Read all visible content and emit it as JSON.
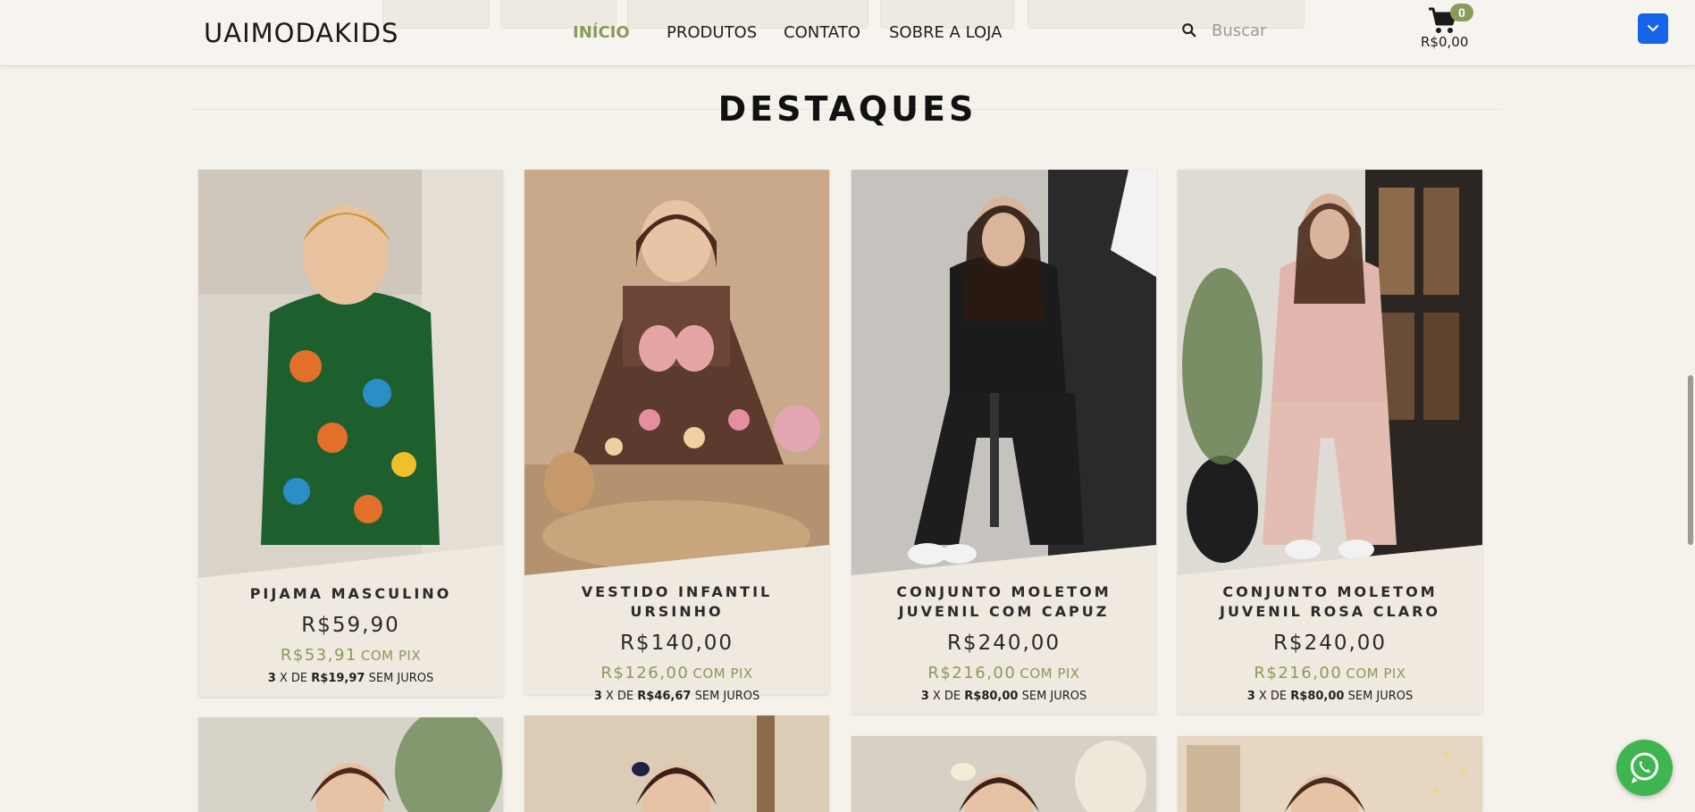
{
  "header": {
    "logo": "UAIMODAKIDS",
    "nav": [
      "INÍCIO",
      "PRODUTOS",
      "CONTATO",
      "SOBRE A LOJA"
    ],
    "search_placeholder": "Buscar",
    "cart_count": "0",
    "cart_total": "R$0,00"
  },
  "section": {
    "title": "DESTAQUES"
  },
  "products": [
    {
      "name": "PIJAMA MASCULINO",
      "price": "R$59,90",
      "pix_price": "R$53,91",
      "pix_label": "COM PIX",
      "inst_count": "3",
      "inst_x": "X DE",
      "inst_value": "R$19,97",
      "inst_suffix": "SEM JUROS"
    },
    {
      "name": "VESTIDO INFANTIL URSINHO",
      "price": "R$140,00",
      "pix_price": "R$126,00",
      "pix_label": "COM PIX",
      "inst_count": "3",
      "inst_x": "X DE",
      "inst_value": "R$46,67",
      "inst_suffix": "SEM JUROS"
    },
    {
      "name": "CONJUNTO MOLETOM JUVENIL COM CAPUZ",
      "price": "R$240,00",
      "pix_price": "R$216,00",
      "pix_label": "COM PIX",
      "inst_count": "3",
      "inst_x": "X DE",
      "inst_value": "R$80,00",
      "inst_suffix": "SEM JUROS"
    },
    {
      "name": "CONJUNTO MOLETOM JUVENIL ROSA CLARO",
      "price": "R$240,00",
      "pix_price": "R$216,00",
      "pix_label": "COM PIX",
      "inst_count": "3",
      "inst_x": "X DE",
      "inst_value": "R$80,00",
      "inst_suffix": "SEM JUROS"
    }
  ],
  "colors": {
    "accent": "#8a9a5b",
    "background": "#f5f1eb",
    "card": "#efe9df",
    "whatsapp": "#3fb54f",
    "menu_button": "#1463e8"
  }
}
